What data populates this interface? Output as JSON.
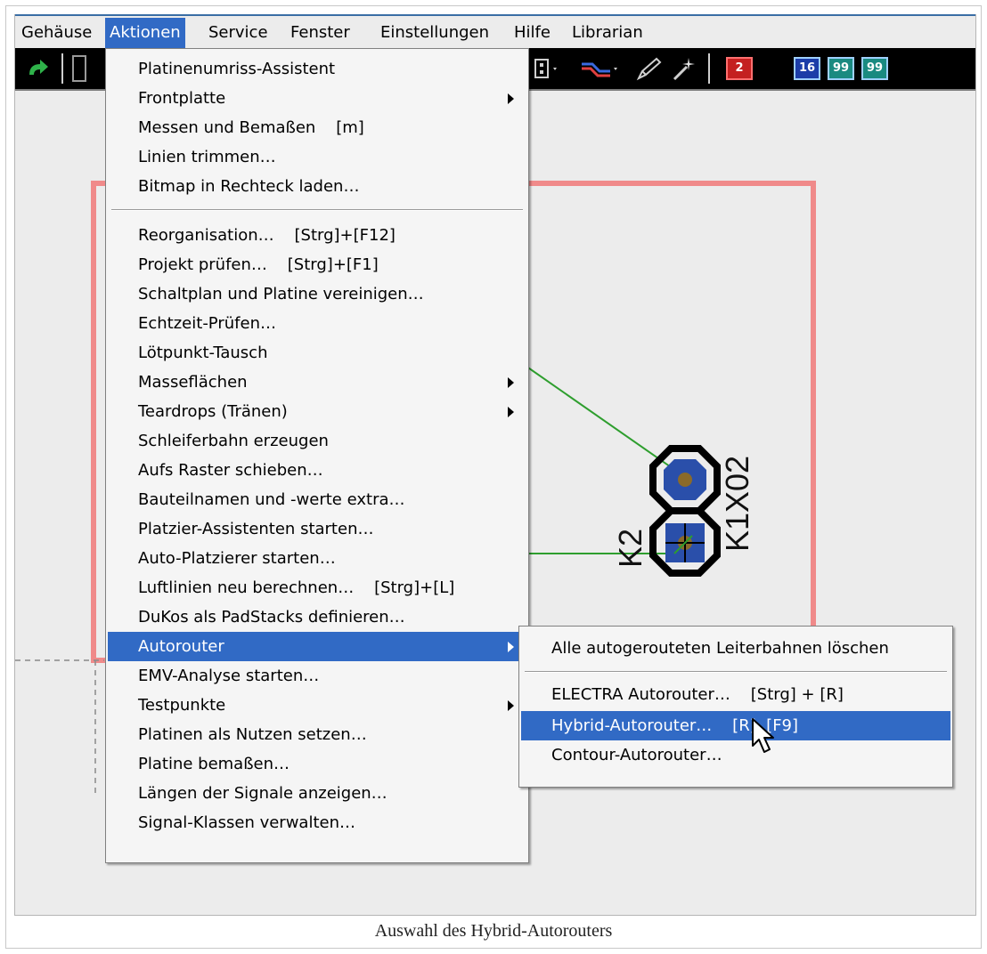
{
  "menubar": {
    "items": [
      "Gehäuse",
      "Aktionen",
      "Service",
      "Fenster",
      "Einstellungen",
      "Hilfe",
      "Librarian"
    ],
    "active_index": 1
  },
  "toolbar": {
    "number_buttons": [
      "2",
      "16",
      "99",
      "99"
    ]
  },
  "board": {
    "component_ref": "K2",
    "component_value": "K1X02"
  },
  "actions_menu": {
    "items": [
      {
        "label": "Platinenumriss-Assistent",
        "submenu": false
      },
      {
        "label": "Frontplatte",
        "submenu": true
      },
      {
        "label": "Messen und Bemaßen    [m]",
        "submenu": false
      },
      {
        "label": "Linien trimmen…",
        "submenu": false
      },
      {
        "label": "Bitmap in Rechteck laden…",
        "submenu": false
      },
      {
        "separator": true
      },
      {
        "label": "Reorganisation…    [Strg]+[F12]",
        "submenu": false
      },
      {
        "label": "Projekt prüfen…    [Strg]+[F1]",
        "submenu": false
      },
      {
        "label": "Schaltplan und Platine vereinigen…",
        "submenu": false
      },
      {
        "label": "Echtzeit-Prüfen…",
        "submenu": false
      },
      {
        "label": "Lötpunkt-Tausch",
        "submenu": false
      },
      {
        "label": "Masseflächen",
        "submenu": true
      },
      {
        "label": "Teardrops (Tränen)",
        "submenu": true
      },
      {
        "label": "Schleiferbahn erzeugen",
        "submenu": false
      },
      {
        "label": "Aufs Raster schieben…",
        "submenu": false
      },
      {
        "label": "Bauteilnamen und -werte extra…",
        "submenu": false
      },
      {
        "label": "Platzier-Assistenten starten…",
        "submenu": false
      },
      {
        "label": "Auto-Platzierer starten…",
        "submenu": false
      },
      {
        "label": "Luftlinien neu berechnen…    [Strg]+[L]",
        "submenu": false
      },
      {
        "label": "DuKos als PadStacks definieren…",
        "submenu": false
      },
      {
        "label": "Autorouter",
        "submenu": true,
        "highlighted": true
      },
      {
        "label": "EMV-Analyse starten…",
        "submenu": false
      },
      {
        "label": "Testpunkte",
        "submenu": true
      },
      {
        "label": "Platinen als Nutzen setzen…",
        "submenu": false
      },
      {
        "label": "Platine bemaßen…",
        "submenu": false
      },
      {
        "label": "Längen der Signale anzeigen…",
        "submenu": false
      },
      {
        "label": "Signal-Klassen verwalten…",
        "submenu": false
      }
    ]
  },
  "autorouter_submenu": {
    "items": [
      {
        "label": "Alle autogerouteten Leiterbahnen löschen"
      },
      {
        "separator": true
      },
      {
        "label": "ELECTRA Autorouter…    [Strg] + [R]"
      },
      {
        "label": "Hybrid-Autorouter…    [R], [F9]",
        "highlighted": true
      },
      {
        "label": "Contour-Autorouter…"
      }
    ]
  },
  "caption": "Auswahl des Hybrid-Autorouters",
  "colors": {
    "highlight": "#316ac5",
    "board_outline": "#f08a8a",
    "ratsnest": "#2e9e2e",
    "pad": "#2a4faa"
  }
}
